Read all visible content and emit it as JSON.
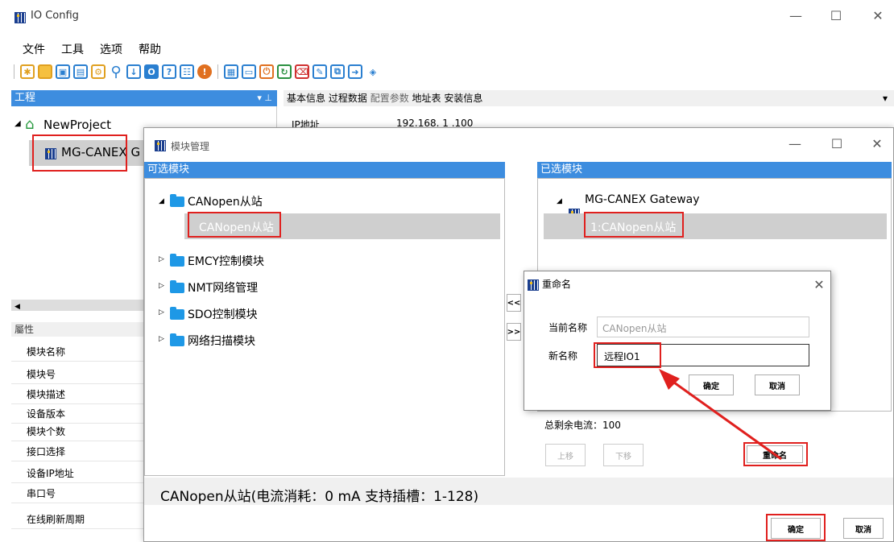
{
  "app": {
    "title": "IO Config"
  },
  "menu": [
    "文件",
    "工具",
    "选项",
    "帮助"
  ],
  "project_panel": {
    "header": "工程",
    "root": "NewProject",
    "child": "MG-CANEX G"
  },
  "props": {
    "header": "屬性",
    "rows": [
      "模块名称",
      "模块号",
      "模块描述",
      "设备版本",
      "模块个数",
      "接口选择",
      "设备IP地址",
      "串口号",
      "在线刷新周期"
    ]
  },
  "tabs": [
    "基本信息",
    "过程数据",
    "配置参数",
    "地址表",
    "安装信息"
  ],
  "ip": {
    "label": "IP地址",
    "value": "192.168. 1 .100"
  },
  "module_dialog": {
    "title": "模块管理",
    "available_header": "可选模块",
    "available": [
      {
        "label": "CANopen从站",
        "child": "CANopen从站"
      },
      {
        "label": "EMCY控制模块"
      },
      {
        "label": "NMT网络管理"
      },
      {
        "label": "SDO控制模块"
      },
      {
        "label": "网络扫描模块"
      }
    ],
    "selected_header": "已选模块",
    "gateway": "MG-CANEX Gateway",
    "selected_item": "1:CANopen从站",
    "current_left": "总剩余电流：100",
    "up": "上移",
    "down": "下移",
    "rename": "重命名",
    "add": "<<",
    "remove": ">>",
    "status": "CANopen从站(电流消耗：0 mA  支持插槽：1-128)",
    "ok": "确定",
    "cancel": "取消"
  },
  "rename_dialog": {
    "title": "重命名",
    "current_label": "当前名称",
    "current_value": "CANopen从站",
    "new_label": "新名称",
    "new_value": "远程IO1",
    "ok": "确定",
    "cancel": "取消"
  },
  "colors": {
    "header_blue": "#3d8ddf",
    "highlight_red": "#e0201e",
    "selection_gray": "#cfcfcf"
  }
}
